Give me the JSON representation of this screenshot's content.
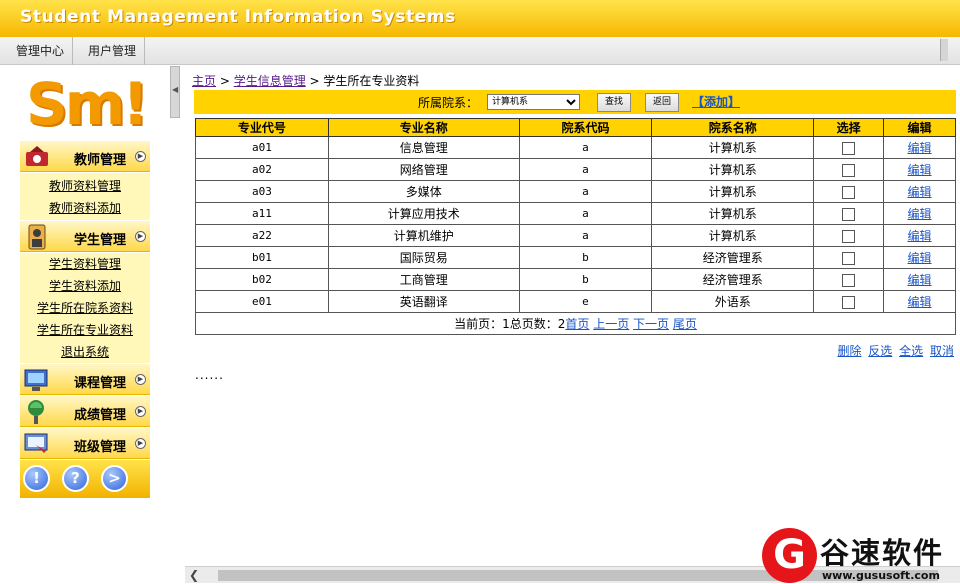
{
  "app": {
    "title": "Student Management Information Systems"
  },
  "topnav": {
    "items": [
      "管理中心",
      "用户管理"
    ]
  },
  "logo": {
    "text": "Sm!"
  },
  "sidebar": {
    "groups": [
      {
        "label": "教师管理",
        "icon": "teacher-icon",
        "items": [
          "教师资料管理",
          "教师资料添加"
        ]
      },
      {
        "label": "学生管理",
        "icon": "student-icon",
        "items": [
          "学生资料管理",
          "学生资料添加",
          "学生所在院系资料",
          "学生所在专业资料",
          "退出系统"
        ]
      },
      {
        "label": "课程管理",
        "icon": "course-icon",
        "items": []
      },
      {
        "label": "成绩管理",
        "icon": "score-icon",
        "items": []
      },
      {
        "label": "班级管理",
        "icon": "class-icon",
        "items": []
      }
    ],
    "bottom_buttons": [
      "!",
      "?",
      ">"
    ]
  },
  "breadcrumb": {
    "home": "主页",
    "sep": " > ",
    "section": "学生信息管理",
    "current": "学生所在专业资料"
  },
  "filter": {
    "label": "所属院系：",
    "selected": "计算机系",
    "search_label": "查找",
    "back_label": "返回",
    "add_label": "【添加】"
  },
  "table": {
    "columns": [
      "专业代号",
      "专业名称",
      "院系代码",
      "院系名称",
      "选择",
      "编辑"
    ],
    "rows": [
      {
        "code": "a01",
        "name": "信息管理",
        "dept_code": "a",
        "dept_name": "计算机系",
        "edit": "编辑"
      },
      {
        "code": "a02",
        "name": "网络管理",
        "dept_code": "a",
        "dept_name": "计算机系",
        "edit": "编辑"
      },
      {
        "code": "a03",
        "name": "多媒体",
        "dept_code": "a",
        "dept_name": "计算机系",
        "edit": "编辑"
      },
      {
        "code": "a11",
        "name": "计算应用技术",
        "dept_code": "a",
        "dept_name": "计算机系",
        "edit": "编辑"
      },
      {
        "code": "a22",
        "name": "计算机维护",
        "dept_code": "a",
        "dept_name": "计算机系",
        "edit": "编辑"
      },
      {
        "code": "b01",
        "name": "国际贸易",
        "dept_code": "b",
        "dept_name": "经济管理系",
        "edit": "编辑"
      },
      {
        "code": "b02",
        "name": "工商管理",
        "dept_code": "b",
        "dept_name": "经济管理系",
        "edit": "编辑"
      },
      {
        "code": "e01",
        "name": "英语翻译",
        "dept_code": "e",
        "dept_name": "外语系",
        "edit": "编辑"
      }
    ],
    "pager": {
      "prefix": "当前页：1总页数：2",
      "first": "首页",
      "prev": "上一页",
      "next": "下一页",
      "last": "尾页"
    }
  },
  "actions": {
    "delete": "删除",
    "invert": "反选",
    "select_all": "全选",
    "cancel": "取消"
  },
  "dots": "......",
  "watermark": {
    "mark": "G",
    "name": "谷速软件",
    "url": "www.gususoft.com"
  }
}
